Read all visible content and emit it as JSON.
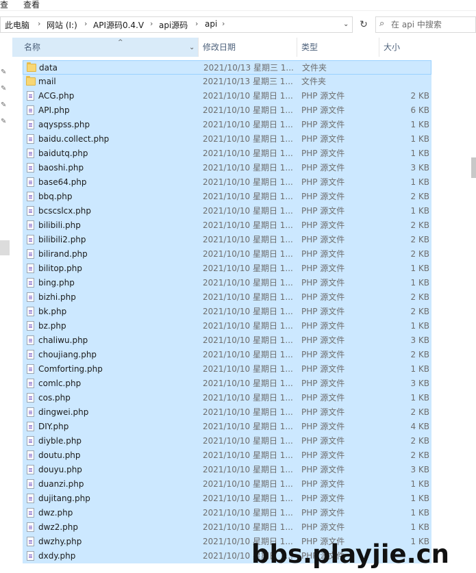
{
  "ribbon": {
    "items": [
      "查",
      "查看"
    ]
  },
  "address": {
    "crumbs": [
      "此电脑",
      "网站 (I:)",
      "API源码0.4.V",
      "api源码",
      "api"
    ]
  },
  "search": {
    "placeholder": "在 api 中搜索"
  },
  "columns": {
    "name": "名称",
    "date": "修改日期",
    "type": "类型",
    "size": "大小"
  },
  "files": [
    {
      "name": "data",
      "date": "2021/10/13 星期三 1...",
      "type": "文件夹",
      "size": "",
      "kind": "folder"
    },
    {
      "name": "mail",
      "date": "2021/10/13 星期三 1...",
      "type": "文件夹",
      "size": "",
      "kind": "folder"
    },
    {
      "name": "ACG.php",
      "date": "2021/10/10 星期日 1...",
      "type": "PHP 源文件",
      "size": "2 KB",
      "kind": "file"
    },
    {
      "name": "API.php",
      "date": "2021/10/10 星期日 1...",
      "type": "PHP 源文件",
      "size": "6 KB",
      "kind": "file"
    },
    {
      "name": "aqyspss.php",
      "date": "2021/10/10 星期日 1...",
      "type": "PHP 源文件",
      "size": "1 KB",
      "kind": "file"
    },
    {
      "name": "baidu.collect.php",
      "date": "2021/10/10 星期日 1...",
      "type": "PHP 源文件",
      "size": "1 KB",
      "kind": "file"
    },
    {
      "name": "baidutq.php",
      "date": "2021/10/10 星期日 1...",
      "type": "PHP 源文件",
      "size": "1 KB",
      "kind": "file"
    },
    {
      "name": "baoshi.php",
      "date": "2021/10/10 星期日 1...",
      "type": "PHP 源文件",
      "size": "3 KB",
      "kind": "file"
    },
    {
      "name": "base64.php",
      "date": "2021/10/10 星期日 1...",
      "type": "PHP 源文件",
      "size": "1 KB",
      "kind": "file"
    },
    {
      "name": "bbq.php",
      "date": "2021/10/10 星期日 1...",
      "type": "PHP 源文件",
      "size": "2 KB",
      "kind": "file"
    },
    {
      "name": "bcscslcx.php",
      "date": "2021/10/10 星期日 1...",
      "type": "PHP 源文件",
      "size": "1 KB",
      "kind": "file"
    },
    {
      "name": "bilibili.php",
      "date": "2021/10/10 星期日 1...",
      "type": "PHP 源文件",
      "size": "2 KB",
      "kind": "file"
    },
    {
      "name": "bilibili2.php",
      "date": "2021/10/10 星期日 1...",
      "type": "PHP 源文件",
      "size": "2 KB",
      "kind": "file"
    },
    {
      "name": "bilirand.php",
      "date": "2021/10/10 星期日 1...",
      "type": "PHP 源文件",
      "size": "2 KB",
      "kind": "file"
    },
    {
      "name": "bilitop.php",
      "date": "2021/10/10 星期日 1...",
      "type": "PHP 源文件",
      "size": "1 KB",
      "kind": "file"
    },
    {
      "name": "bing.php",
      "date": "2021/10/10 星期日 1...",
      "type": "PHP 源文件",
      "size": "1 KB",
      "kind": "file"
    },
    {
      "name": "bizhi.php",
      "date": "2021/10/10 星期日 1...",
      "type": "PHP 源文件",
      "size": "2 KB",
      "kind": "file"
    },
    {
      "name": "bk.php",
      "date": "2021/10/10 星期日 1...",
      "type": "PHP 源文件",
      "size": "2 KB",
      "kind": "file"
    },
    {
      "name": "bz.php",
      "date": "2021/10/10 星期日 1...",
      "type": "PHP 源文件",
      "size": "1 KB",
      "kind": "file"
    },
    {
      "name": "chaliwu.php",
      "date": "2021/10/10 星期日 1...",
      "type": "PHP 源文件",
      "size": "3 KB",
      "kind": "file"
    },
    {
      "name": "choujiang.php",
      "date": "2021/10/10 星期日 1...",
      "type": "PHP 源文件",
      "size": "2 KB",
      "kind": "file"
    },
    {
      "name": "Comforting.php",
      "date": "2021/10/10 星期日 1...",
      "type": "PHP 源文件",
      "size": "1 KB",
      "kind": "file"
    },
    {
      "name": "comlc.php",
      "date": "2021/10/10 星期日 1...",
      "type": "PHP 源文件",
      "size": "3 KB",
      "kind": "file"
    },
    {
      "name": "cos.php",
      "date": "2021/10/10 星期日 1...",
      "type": "PHP 源文件",
      "size": "1 KB",
      "kind": "file"
    },
    {
      "name": "dingwei.php",
      "date": "2021/10/10 星期日 1...",
      "type": "PHP 源文件",
      "size": "2 KB",
      "kind": "file"
    },
    {
      "name": "DIY.php",
      "date": "2021/10/10 星期日 1...",
      "type": "PHP 源文件",
      "size": "4 KB",
      "kind": "file"
    },
    {
      "name": "diyble.php",
      "date": "2021/10/10 星期日 1...",
      "type": "PHP 源文件",
      "size": "2 KB",
      "kind": "file"
    },
    {
      "name": "doutu.php",
      "date": "2021/10/10 星期日 1...",
      "type": "PHP 源文件",
      "size": "2 KB",
      "kind": "file"
    },
    {
      "name": "douyu.php",
      "date": "2021/10/10 星期日 1...",
      "type": "PHP 源文件",
      "size": "3 KB",
      "kind": "file"
    },
    {
      "name": "duanzi.php",
      "date": "2021/10/10 星期日 1...",
      "type": "PHP 源文件",
      "size": "1 KB",
      "kind": "file"
    },
    {
      "name": "dujitang.php",
      "date": "2021/10/10 星期日 1...",
      "type": "PHP 源文件",
      "size": "1 KB",
      "kind": "file"
    },
    {
      "name": "dwz.php",
      "date": "2021/10/10 星期日 1...",
      "type": "PHP 源文件",
      "size": "1 KB",
      "kind": "file"
    },
    {
      "name": "dwz2.php",
      "date": "2021/10/10 星期日 1...",
      "type": "PHP 源文件",
      "size": "1 KB",
      "kind": "file"
    },
    {
      "name": "dwzhy.php",
      "date": "2021/10/10 星期日 1...",
      "type": "PHP 源文件",
      "size": "1 KB",
      "kind": "file"
    },
    {
      "name": "dxdy.php",
      "date": "2021/10/10 星期日 1...",
      "type": "PHP 源文件",
      "size": "",
      "kind": "file"
    }
  ],
  "watermark": "bbs.playjie.cn",
  "colors": {
    "selection": "#cce8ff",
    "selection_border": "#99d1ff",
    "header_active": "#d9ebf9",
    "folder": "#f8d775"
  },
  "icons": {
    "folder": "folder-icon",
    "file": "php-file-icon",
    "refresh": "refresh-icon",
    "search": "search-icon",
    "pin": "pin-icon"
  }
}
